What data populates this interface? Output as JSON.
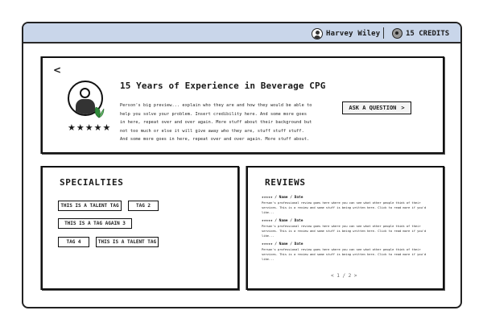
{
  "header": {
    "user_name": "Harvey Wiley",
    "credits_label": "15 CREDITS"
  },
  "hero": {
    "back_label": "<",
    "title": "15 Years of Experience in Beverage CPG",
    "description": "Person's big preview... explain who they are and how they would be able to help you solve your problem. Insert credibility here. And some more goes in here, repeat over and over again. More stuff about their background but not too much or else it will give away who they are, stuff stuff stuff. And some more goes in here, repeat over and over again. More stuff about.",
    "rating_stars": "★★★★★",
    "ask_button_label": "ASK A QUESTION",
    "ask_button_arrow": ">"
  },
  "specialties": {
    "title": "SPECIALTIES",
    "tags": [
      "THIS IS A TALENT TAG",
      "TAG 2",
      "THIS IS A TAG AGAIN 3",
      "TAG 4",
      "THIS IS A TALENT TAG"
    ]
  },
  "reviews": {
    "title": "REVIEWS",
    "items": [
      {
        "header": "★★★★★ / Name / Date",
        "body": "Person's professional review goes here where you can see what other people think of their services. This is a review and some stuff is being written here. Click to read more if you'd like..."
      },
      {
        "header": "★★★★★ / Name / Date",
        "body": "Person's professional review goes here where you can see what other people think of their services. This is a review and some stuff is being written here. Click to read more if you'd like..."
      },
      {
        "header": "★★★★★ / Name / Date",
        "body": "Person's professional review goes here where you can see what other people think of their services. This is a review and some stuff is being written here. Click to read more if you'd like..."
      }
    ],
    "pager": "< 1 / 2 >"
  }
}
